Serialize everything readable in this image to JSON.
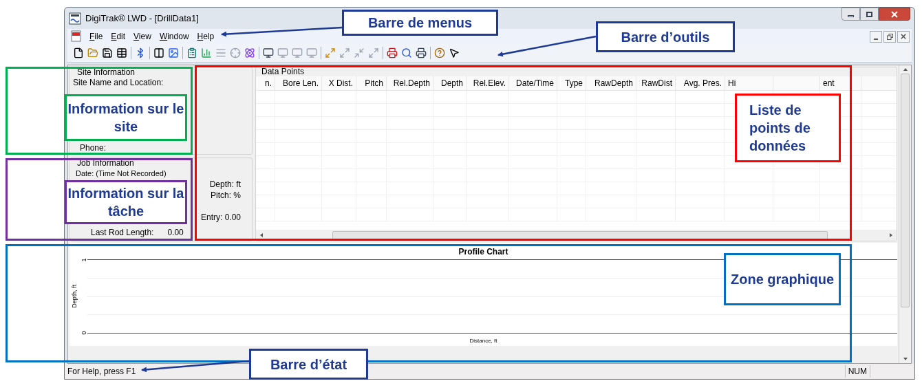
{
  "window": {
    "title": "DigiTrak® LWD - [DrillData1]"
  },
  "menu": [
    "File",
    "Edit",
    "View",
    "Window",
    "Help"
  ],
  "site_information": {
    "title": "Site Information",
    "fields": [
      "Site Name and Location:",
      "Phone:"
    ]
  },
  "job_information": {
    "title": "Job Information",
    "date": "Date:  (Time Not Recorded)",
    "depth": "Depth:  ft",
    "pitch": "Pitch:  %",
    "entry": "Entry: 0.00",
    "last_rod_label": "Last Rod Length:",
    "last_rod_value": "0.00"
  },
  "data_points": {
    "title": "Data Points",
    "columns": [
      "n.",
      "Bore Len.",
      "X Dist.",
      "Pitch",
      "Rel.Depth",
      "Depth",
      "Rel.Elev.",
      "Date/Time",
      "Type",
      "RawDepth",
      "RawDist",
      "Avg. Pres.",
      "Hi",
      "",
      "ent"
    ]
  },
  "profile_chart": {
    "title": "Profile Chart",
    "y_label": "Depth, ft",
    "x_label": "Distance, ft",
    "y_ticks": [
      "1",
      "0"
    ]
  },
  "status_bar": {
    "help": "For Help, press F1",
    "indicator": "NUM"
  },
  "callouts": [
    {
      "kind": "arrow",
      "text": "Barre de menus",
      "color": "#1f3a93"
    },
    {
      "kind": "arrow",
      "text": "Barre d’outils",
      "color": "#1f3a93"
    },
    {
      "kind": "frame",
      "text": "Information sur le site",
      "color": "#00b050"
    },
    {
      "kind": "frame",
      "text": "Information sur la tâche",
      "color": "#7030a0"
    },
    {
      "kind": "frame",
      "text": "Liste de points de données",
      "color": "#ff0000"
    },
    {
      "kind": "frame",
      "text": "Zone graphique",
      "color": "#0070c0"
    },
    {
      "kind": "arrow",
      "text": "Barre d’état",
      "color": "#1f3a93"
    }
  ]
}
